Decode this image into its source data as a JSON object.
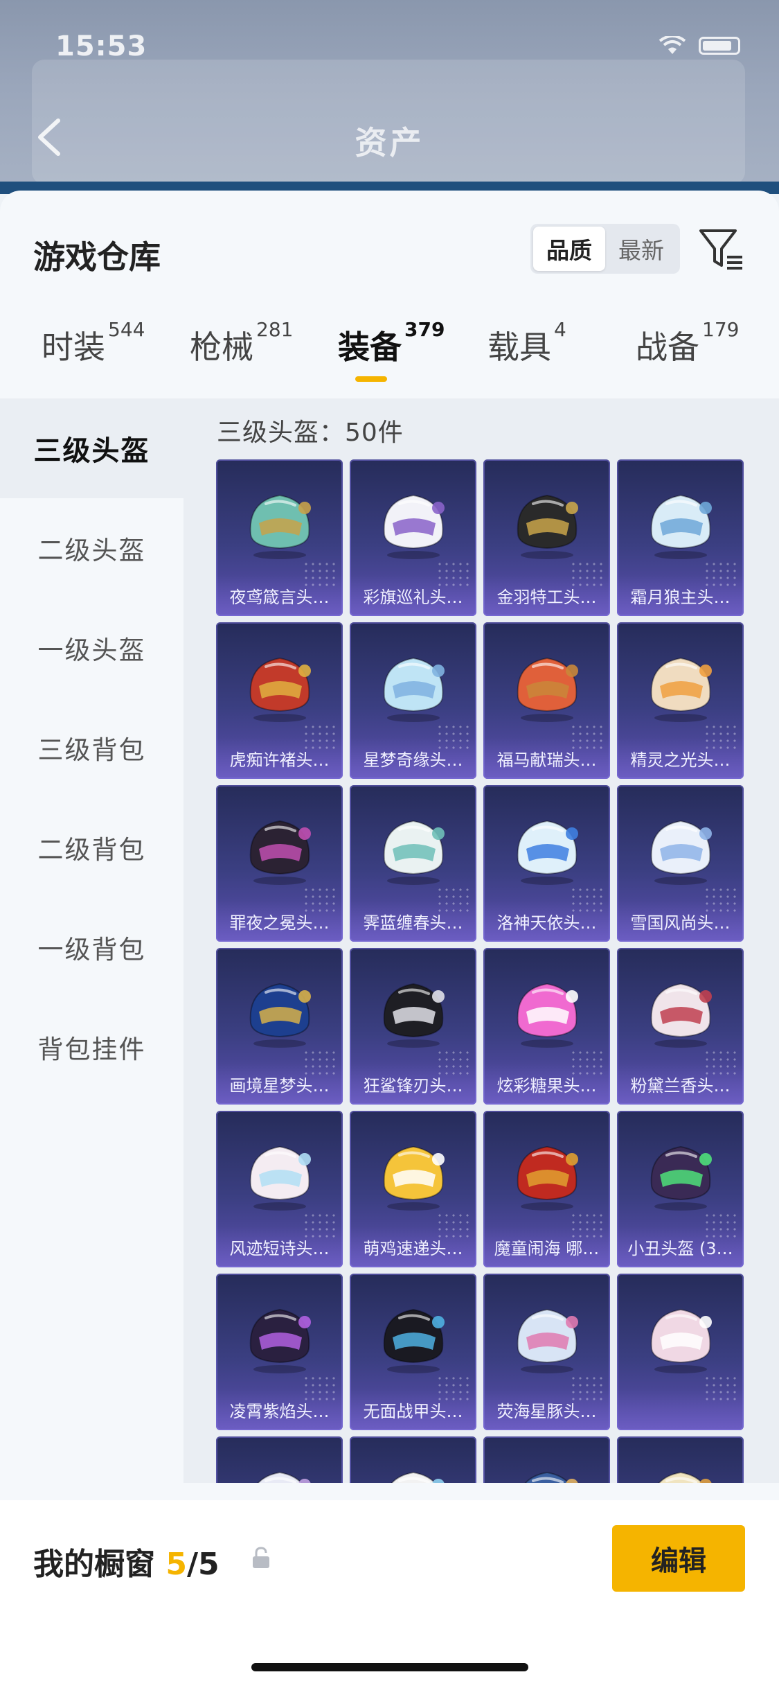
{
  "status_bar": {
    "time": "15:53"
  },
  "background_header": {
    "title": "资产"
  },
  "panel": {
    "title": "游戏仓库",
    "sort_options": [
      {
        "label": "品质",
        "active": true
      },
      {
        "label": "最新",
        "active": false
      }
    ]
  },
  "tabs": [
    {
      "label": "时装",
      "count": "544",
      "active": false
    },
    {
      "label": "枪械",
      "count": "281",
      "active": false
    },
    {
      "label": "装备",
      "count": "379",
      "active": true
    },
    {
      "label": "载具",
      "count": "4",
      "active": false
    },
    {
      "label": "战备",
      "count": "179",
      "active": false
    }
  ],
  "sidebar": {
    "items": [
      {
        "label": "三级头盔",
        "active": true
      },
      {
        "label": "二级头盔",
        "active": false
      },
      {
        "label": "一级头盔",
        "active": false
      },
      {
        "label": "三级背包",
        "active": false
      },
      {
        "label": "二级背包",
        "active": false
      },
      {
        "label": "一级背包",
        "active": false
      },
      {
        "label": "背包挂件",
        "active": false
      }
    ]
  },
  "content": {
    "section_title": "三级头盔：50件",
    "items": [
      {
        "name": "夜鸢箴言头…",
        "colors": [
          "#6fbfb0",
          "#c8a24a"
        ]
      },
      {
        "name": "彩旗巡礼头…",
        "colors": [
          "#f2f2f8",
          "#8a63c9"
        ]
      },
      {
        "name": "金羽特工头…",
        "colors": [
          "#2a2a2a",
          "#c9a54a"
        ]
      },
      {
        "name": "霜月狼主头…",
        "colors": [
          "#d9ecf7",
          "#6fa8d8"
        ]
      },
      {
        "name": "虎痴许褚头…",
        "colors": [
          "#c23a2a",
          "#e0b040"
        ]
      },
      {
        "name": "星梦奇缘头…",
        "colors": [
          "#bfe4f5",
          "#7fb2e0"
        ]
      },
      {
        "name": "福马献瑞头…",
        "colors": [
          "#e0603a",
          "#c9873a"
        ]
      },
      {
        "name": "精灵之光头…",
        "colors": [
          "#f0dcc0",
          "#f0a040"
        ]
      },
      {
        "name": "罪夜之冕头…",
        "colors": [
          "#2b2233",
          "#c04fb0"
        ]
      },
      {
        "name": "霁蓝缠春头…",
        "colors": [
          "#eaf2f2",
          "#6fc0b8"
        ]
      },
      {
        "name": "洛神天依头…",
        "colors": [
          "#dff0fa",
          "#3f7fe0"
        ]
      },
      {
        "name": "雪国风尚头…",
        "colors": [
          "#eaf0fa",
          "#8fb4e8"
        ]
      },
      {
        "name": "画境星梦头…",
        "colors": [
          "#1d3f8f",
          "#d6b04a"
        ]
      },
      {
        "name": "狂鲨锋刃头…",
        "colors": [
          "#1e1e24",
          "#e0e0e8"
        ]
      },
      {
        "name": "炫彩糖果头…",
        "colors": [
          "#f06ad0",
          "#ffffff"
        ]
      },
      {
        "name": "粉黛兰香头…",
        "colors": [
          "#f0e4ea",
          "#c04050"
        ]
      },
      {
        "name": "风迹短诗头…",
        "colors": [
          "#f4ecf2",
          "#b0dff5"
        ]
      },
      {
        "name": "萌鸡速递头…",
        "colors": [
          "#f5c43a",
          "#ffffff"
        ]
      },
      {
        "name": "魔童闹海 哪…",
        "colors": [
          "#c02a20",
          "#e0a030"
        ]
      },
      {
        "name": "小丑头盔 (3…",
        "colors": [
          "#3a2a55",
          "#4fe07a"
        ]
      },
      {
        "name": "凌霄紫焰头…",
        "colors": [
          "#2a2040",
          "#b060e0"
        ]
      },
      {
        "name": "无面战甲头…",
        "colors": [
          "#1a1a22",
          "#4fb0e0"
        ]
      },
      {
        "name": "荧海星豚头…",
        "colors": [
          "#d8e4f5",
          "#e07ab0"
        ]
      },
      {
        "name": "",
        "colors": [
          "#f0d8e4",
          "#ffffff"
        ]
      },
      {
        "name": "",
        "colors": [
          "#e8eaf5",
          "#c0a0e0"
        ]
      },
      {
        "name": "",
        "colors": [
          "#f2f2f2",
          "#8fd0f0"
        ]
      },
      {
        "name": "",
        "colors": [
          "#3a5fa0",
          "#e0b060"
        ]
      },
      {
        "name": "",
        "colors": [
          "#f0e4c0",
          "#e0a040"
        ]
      }
    ]
  },
  "showcase": {
    "label": "我的橱窗",
    "count": "5",
    "total": "/5",
    "edit_label": "编辑"
  }
}
